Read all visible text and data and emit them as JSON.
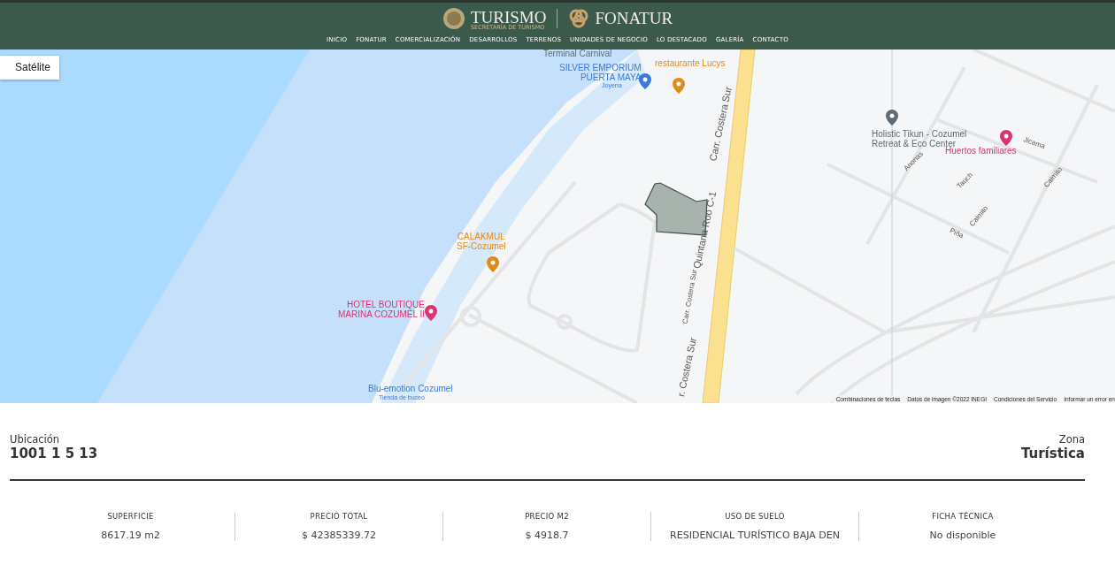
{
  "header": {
    "brand_left": "TURISMO",
    "brand_left_sub": "SECRETARÍA DE TURISMO",
    "brand_right": "FONATUR",
    "nav": [
      {
        "label": "INICIO"
      },
      {
        "label": "FONATUR"
      },
      {
        "label": "COMERCIALIZACIÓN"
      },
      {
        "label": "DESARROLLOS"
      },
      {
        "label": "TERRENOS"
      },
      {
        "label": "UNIDADES DE NEGOCIO"
      },
      {
        "label": "LO DESTACADO"
      },
      {
        "label": "GALERÍA"
      },
      {
        "label": "CONTACTO"
      }
    ]
  },
  "map": {
    "map_type_button": "Satélite",
    "places": [
      {
        "kind": "grey",
        "name": "Terminal Carnival"
      },
      {
        "kind": "blue",
        "name": "SILVER EMPORIUM\nPUERTA MAYA",
        "sub": "Joyería"
      },
      {
        "kind": "orange",
        "name": "restaurante Lucys"
      },
      {
        "kind": "grey",
        "name": "Holistic Tikun - Cozumel\nRetreat & Eco Center"
      },
      {
        "kind": "pink",
        "name": "Huertos familiares"
      },
      {
        "kind": "orange",
        "name": "CALAKMUL\nSF-Cozumel"
      },
      {
        "kind": "pink",
        "name": "HOTEL BOUTIQUE\nMARINA COZUMEL II"
      },
      {
        "kind": "blue",
        "name": "Blu-emotion Cozumel",
        "sub": "Tienda de buceo"
      }
    ],
    "streets": [
      "Carr. Costera Sur",
      "Quintana Roo C-1",
      "Carr. Costera Sur",
      "r. Costera Sur",
      "Anonas",
      "Tauch",
      "Jicama",
      "Caimito",
      "Piña",
      "Caimito"
    ],
    "footer": [
      "Combinaciones de teclas",
      "Datos de imagen ©2022 INEGI",
      "Condiciones del Servicio",
      "Informar un error en"
    ]
  },
  "lot": {
    "location_label": "Ubicación",
    "location": "1001 1 5 13",
    "zone_label": "Zona",
    "zone": "Turística",
    "specs": [
      {
        "label": "SUPERFICIE",
        "value": "8617.19 m2"
      },
      {
        "label": "PRECIO TOTAL",
        "value": "$ 42385339.72"
      },
      {
        "label": "PRECIO M2",
        "value": "$ 4918.7"
      },
      {
        "label": "USO DE SUELO",
        "value": "RESIDENCIAL TURÍSTICO BAJA DEN"
      },
      {
        "label": "FICHA TÉCNICA",
        "value": "No disponible"
      }
    ]
  }
}
